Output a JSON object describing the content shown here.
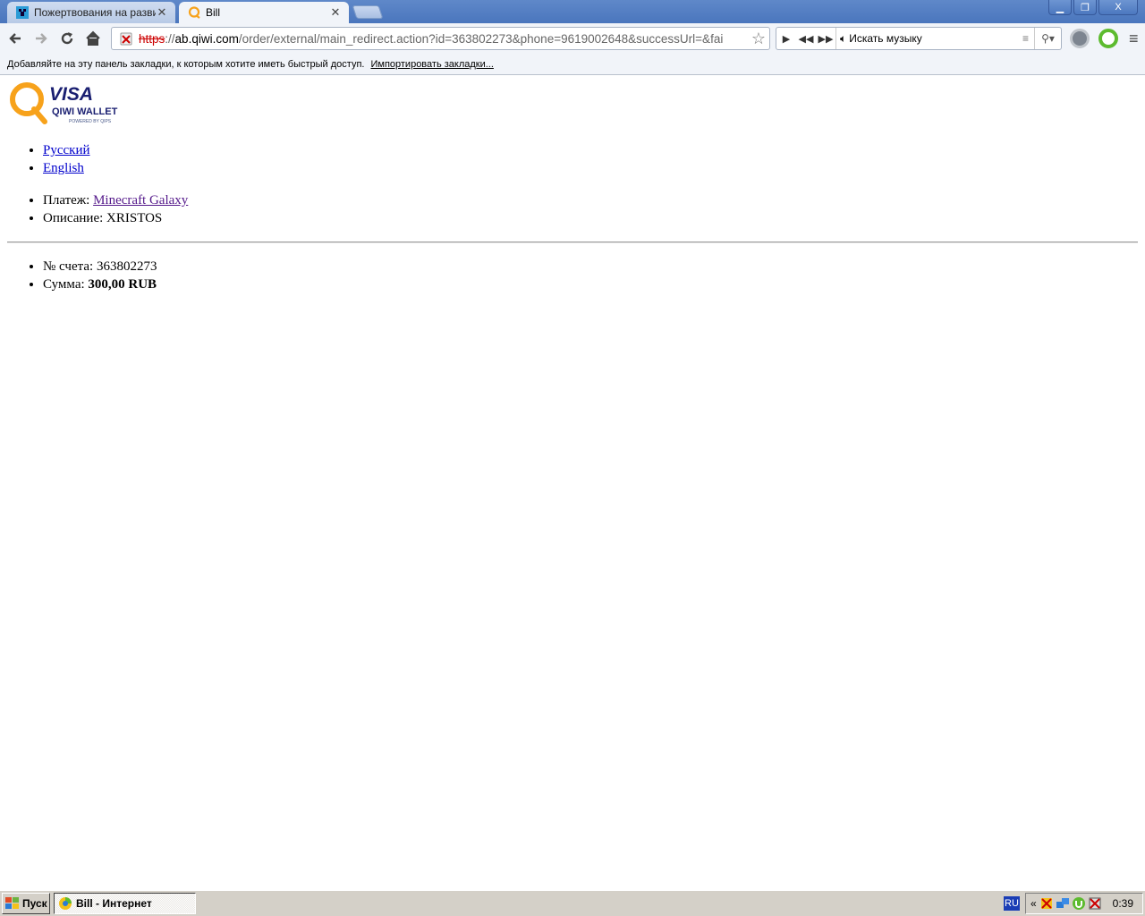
{
  "browser": {
    "tabs": [
      {
        "title": "Пожертвования на развити",
        "active": false
      },
      {
        "title": "Bill",
        "active": true
      }
    ],
    "url": {
      "scheme": "https",
      "host": "ab.qiwi.com",
      "rest": "/order/external/main_redirect.action?id=363802273&phone=9619002648&successUrl=&fai"
    },
    "music_search_placeholder": "Искать музыку",
    "bookmark_bar": {
      "text": "Добавляйте на эту панель закладки, к которым хотите иметь быстрый доступ.",
      "import_link": "Импортировать закладки..."
    },
    "window_buttons": {
      "minimize": "▁",
      "maximize": "❐",
      "close": "X"
    }
  },
  "page": {
    "logo": {
      "brand": "VISA",
      "product": "QIWI WALLET",
      "tagline": "POWERED BY QIPS"
    },
    "languages": [
      {
        "label": "Русский"
      },
      {
        "label": "English"
      }
    ],
    "payment_label": "Платеж:",
    "payment_value": "Minecraft Galaxy",
    "description_label": "Описание:",
    "description_value": "XRISTOS",
    "invoice_label": "№ счета:",
    "invoice_value": "363802273",
    "amount_label": "Сумма:",
    "amount_value": "300,00 RUB"
  },
  "taskbar": {
    "start_label": "Пуск",
    "task_label": "Bill - Интернет",
    "language": "RU",
    "tray_collapse": "«",
    "clock": "0:39"
  },
  "colors": {
    "qiwi_orange": "#f7a21b",
    "visa_blue": "#1a1f71",
    "link": "#0000cc",
    "visited_link": "#551a8b"
  }
}
